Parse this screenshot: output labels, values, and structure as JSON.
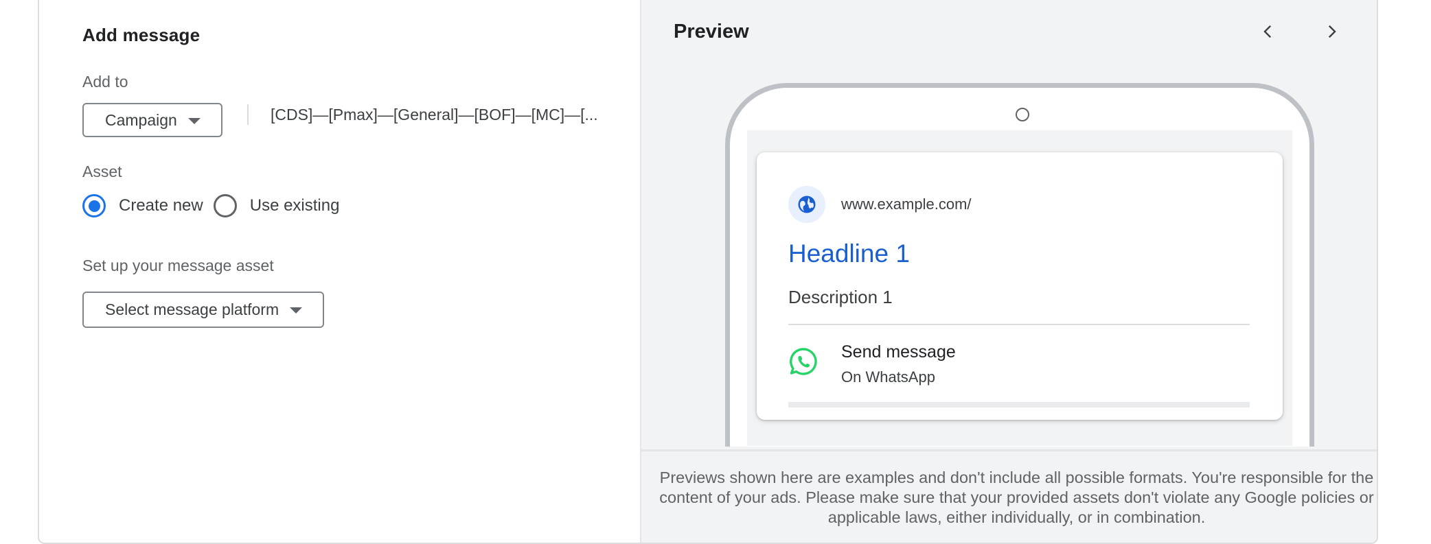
{
  "form": {
    "title": "Add message",
    "add_to_label": "Add to",
    "add_to_value": "Campaign",
    "campaign_name": "[CDS]—[Pmax]—[General]—[BOF]—[MC]—[...",
    "asset_label": "Asset",
    "asset_options": [
      {
        "label": "Create new",
        "selected": true
      },
      {
        "label": "Use existing",
        "selected": false
      }
    ],
    "setup_label": "Set up your message asset",
    "platform_select": "Select message platform"
  },
  "preview": {
    "title": "Preview",
    "icons": [
      "chevron-left-icon",
      "chevron-right-icon",
      "split-view-icon"
    ],
    "ad": {
      "url": "www.example.com/",
      "headline": "Headline 1",
      "description": "Description 1",
      "action_title": "Send message",
      "action_subtitle": "On WhatsApp"
    },
    "disclaimer": "Previews shown here are examples and don't include all possible formats. You're responsible for the content of your ads. Please make sure that your provided assets don't violate any Google policies or applicable laws, either individually, or in combination."
  },
  "colors": {
    "accent": "#1a73e8",
    "headline": "#1a5fd0",
    "whatsapp": "#25d366",
    "preview_bg": "#f1f3f4"
  }
}
